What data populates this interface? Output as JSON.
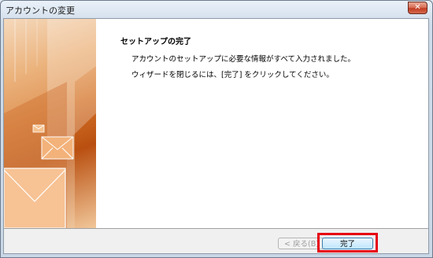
{
  "window": {
    "title": "アカウントの変更",
    "close_label": "✕"
  },
  "content": {
    "heading": "セットアップの完了",
    "line1": "アカウントのセットアップに必要な情報がすべて入力されました。",
    "line2": "ウィザードを閉じるには、[完了] をクリックしてください。"
  },
  "buttons": {
    "back_label": "< 戻る(B)",
    "finish_label": "完了"
  },
  "colors": {
    "highlight": "#e60012",
    "art_orange": "#d5752a"
  },
  "icons": [
    "close-icon",
    "envelope-icon"
  ]
}
